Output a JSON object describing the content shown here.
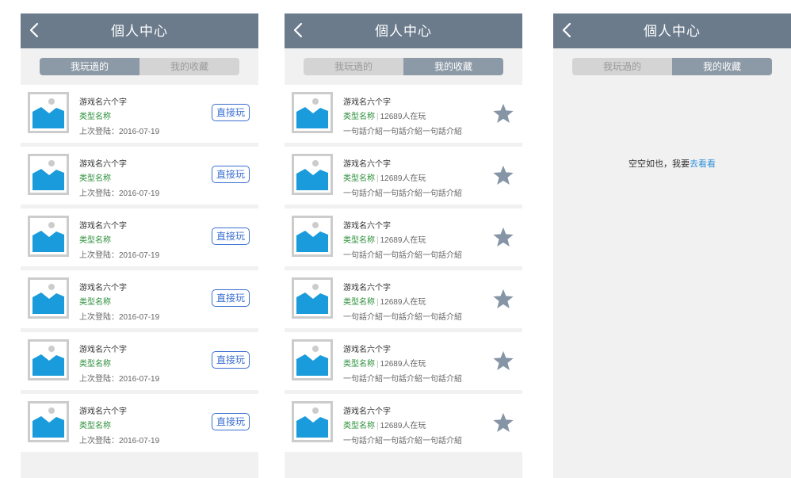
{
  "header": {
    "title": "個人中心"
  },
  "tabs": {
    "played": "我玩過的",
    "favorites": "我的收藏"
  },
  "played_list": [
    {
      "name": "游戏名六个字",
      "category": "类型名称",
      "last_login": "上次登陆：2016-07-19",
      "button": "直接玩"
    },
    {
      "name": "游戏名六个字",
      "category": "类型名称",
      "last_login": "上次登陆：2016-07-19",
      "button": "直接玩"
    },
    {
      "name": "游戏名六个字",
      "category": "类型名称",
      "last_login": "上次登陆：2016-07-19",
      "button": "直接玩"
    },
    {
      "name": "游戏名六个字",
      "category": "类型名称",
      "last_login": "上次登陆：2016-07-19",
      "button": "直接玩"
    },
    {
      "name": "游戏名六个字",
      "category": "类型名称",
      "last_login": "上次登陆：2016-07-19",
      "button": "直接玩"
    },
    {
      "name": "游戏名六个字",
      "category": "类型名称",
      "last_login": "上次登陆：2016-07-19",
      "button": "直接玩"
    }
  ],
  "favorites_list": [
    {
      "name": "游戏名六个字",
      "category": "类型名称",
      "players": "12689人在玩",
      "intro": "一句話介紹一句話介紹一句話介紹"
    },
    {
      "name": "游戏名六个字",
      "category": "类型名称",
      "players": "12689人在玩",
      "intro": "一句話介紹一句話介紹一句話介紹"
    },
    {
      "name": "游戏名六个字",
      "category": "类型名称",
      "players": "12689人在玩",
      "intro": "一句話介紹一句話介紹一句話介紹"
    },
    {
      "name": "游戏名六个字",
      "category": "类型名称",
      "players": "12689人在玩",
      "intro": "一句話介紹一句話介紹一句話介紹"
    },
    {
      "name": "游戏名六个字",
      "category": "类型名称",
      "players": "12689人在玩",
      "intro": "一句話介紹一句話介紹一句話介紹"
    },
    {
      "name": "游戏名六个字",
      "category": "类型名称",
      "players": "12689人在玩",
      "intro": "一句話介紹一句話介紹一句話介紹"
    }
  ],
  "empty_state": {
    "text": "空空如也，我要",
    "link": "去看看"
  },
  "icons": {
    "back": "chevron-left-icon",
    "thumbnail": "image-placeholder-icon",
    "favorite": "star-icon"
  },
  "colors": {
    "header": "#6b7b8c",
    "tab_active": "#8c9aa7",
    "category": "#2c8f3a",
    "play_button": "#3b6fd0",
    "link": "#2e8fd8",
    "star": "#8595a6"
  }
}
